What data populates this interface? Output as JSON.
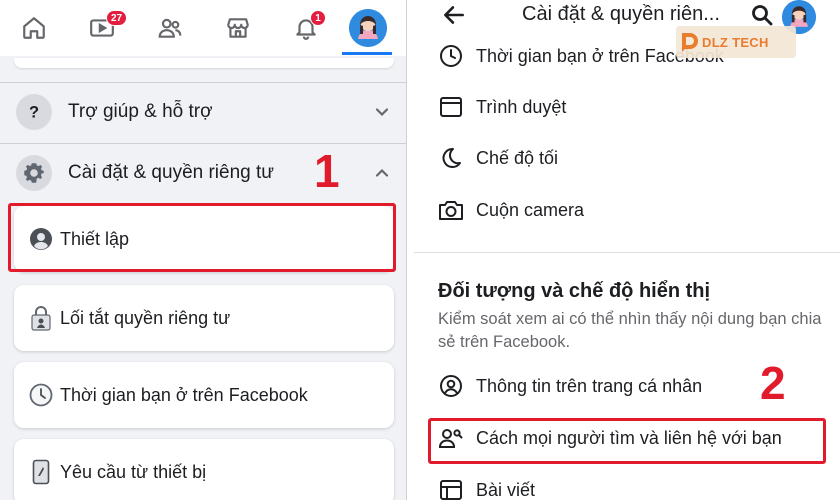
{
  "left": {
    "nav": {
      "video_badge": "27",
      "notification_badge": "1",
      "icons": [
        "home-icon",
        "video-icon",
        "friends-icon",
        "marketplace-icon",
        "bell-icon",
        "profile-avatar"
      ]
    },
    "sections": [
      {
        "label": "Trợ giúp & hỗ trợ",
        "icon": "question-icon",
        "expanded": false
      },
      {
        "label": "Cài đặt & quyền riêng tư",
        "icon": "gear-icon",
        "expanded": true
      }
    ],
    "items": [
      {
        "label": "Thiết lập",
        "icon": "user-circle-icon"
      },
      {
        "label": "Lối tắt quyền riêng tư",
        "icon": "lock-icon"
      },
      {
        "label": "Thời gian bạn ở trên Facebook",
        "icon": "clock-icon"
      },
      {
        "label": "Yêu cầu từ thiết bị",
        "icon": "phone-icon"
      }
    ],
    "step_label": "1"
  },
  "right": {
    "title": "Cài đặt & quyền riên...",
    "items_top": [
      {
        "label": "Thời gian bạn ở trên Facebook",
        "icon": "clock-icon"
      },
      {
        "label": "Trình duyệt",
        "icon": "browser-icon"
      },
      {
        "label": "Chế độ tối",
        "icon": "moon-icon"
      },
      {
        "label": "Cuộn camera",
        "icon": "camera-icon"
      }
    ],
    "section_heading": "Đối tượng và chế độ hiển thị",
    "section_desc": "Kiểm soát xem ai có thể nhìn thấy nội dung bạn chia sẻ trên Facebook.",
    "items_bottom": [
      {
        "label": "Thông tin trên trang cá nhân",
        "icon": "profile-circle-icon"
      },
      {
        "label": "Cách mọi người tìm và liên hệ với bạn",
        "icon": "people-search-icon"
      },
      {
        "label": "Bài viết",
        "icon": "post-icon"
      }
    ],
    "step_label": "2",
    "watermark": "DLZ TECH"
  },
  "colors": {
    "highlight": "#e21b2c",
    "brand_blue": "#1877f2",
    "badge_red": "#e41e3f"
  }
}
